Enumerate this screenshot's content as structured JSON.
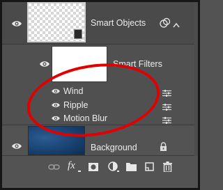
{
  "layers": {
    "smart_object": {
      "name": "Smart Objects"
    },
    "smart_filters": {
      "label": "Smart Filters",
      "filters": [
        {
          "name": "Wind"
        },
        {
          "name": "Ripple"
        },
        {
          "name": "Motion Blur"
        }
      ]
    },
    "background": {
      "name": "Background"
    }
  },
  "toolbar": {
    "fx_label": "fx"
  },
  "colors": {
    "panel_bg": "#535353",
    "annotation": "#e00000",
    "frame": "#161616"
  }
}
